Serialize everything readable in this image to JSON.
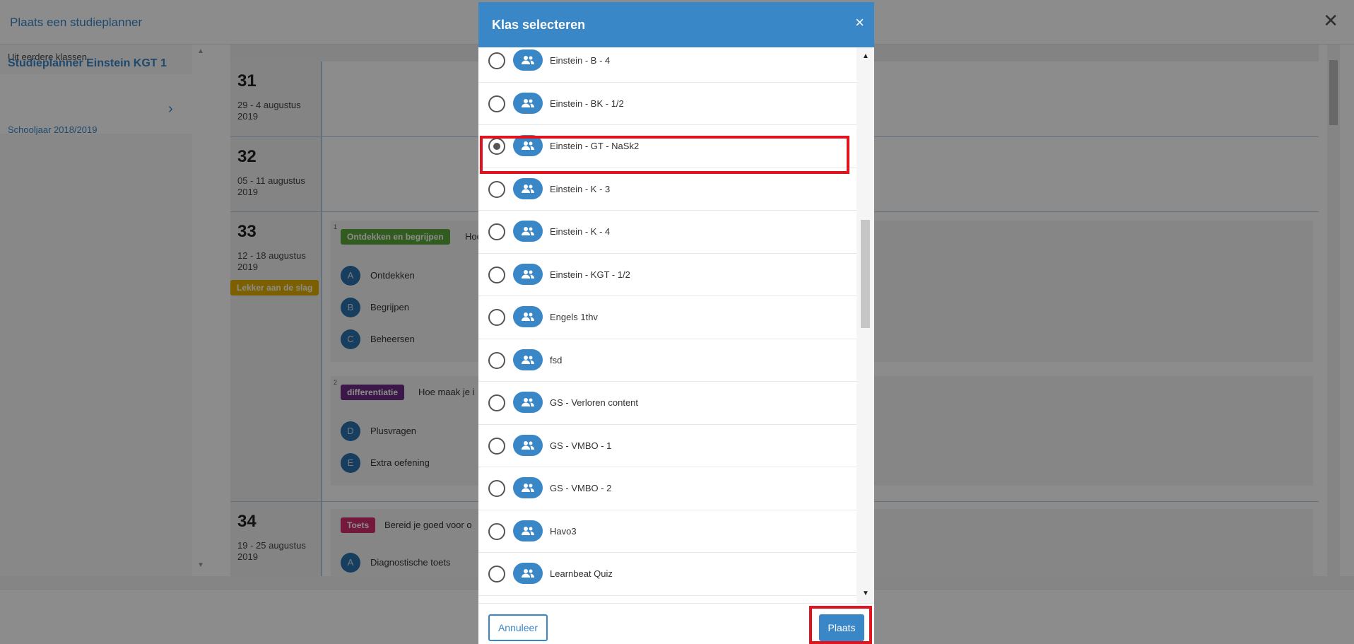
{
  "page": {
    "title": "Plaats een studieplanner",
    "close_icon": "close-icon"
  },
  "sidebar": {
    "previous_label": "Uit eerdere klassen",
    "planner": {
      "title": "Studieplanner Einstein KGT 1",
      "subtitle": "Schooljaar 2018/2019"
    }
  },
  "weeks": [
    {
      "number": "31",
      "dates": "29 - 4 augustus 2019"
    },
    {
      "number": "32",
      "dates": "05 - 11 augustus 2019"
    },
    {
      "number": "33",
      "dates": "12 - 18 augustus 2019",
      "badge": "Lekker aan de slag"
    },
    {
      "number": "34",
      "dates": "19 - 25 augustus 2019"
    }
  ],
  "lessons": [
    {
      "index": "1",
      "chip": "Ontdekken en begrijpen",
      "title": "Hoe",
      "steps": [
        {
          "letter": "A",
          "label": "Ontdekken"
        },
        {
          "letter": "B",
          "label": "Begrijpen"
        },
        {
          "letter": "C",
          "label": "Beheersen"
        }
      ]
    },
    {
      "index": "2",
      "chip": "differentiatie",
      "title": "Hoe maak je i",
      "steps": [
        {
          "letter": "D",
          "label": "Plusvragen"
        },
        {
          "letter": "E",
          "label": "Extra oefening"
        }
      ]
    },
    {
      "chip": "Toets",
      "title": "Bereid je goed voor o",
      "steps": [
        {
          "letter": "A",
          "label": "Diagnostische toets"
        }
      ]
    }
  ],
  "modal": {
    "title": "Klas selecteren",
    "close_symbol": "×",
    "classes": [
      {
        "label": "Einstein - B - 4",
        "selected": false
      },
      {
        "label": "Einstein - BK - 1/2",
        "selected": false
      },
      {
        "label": "Einstein - GT - NaSk2",
        "selected": true
      },
      {
        "label": "Einstein - K - 3",
        "selected": false
      },
      {
        "label": "Einstein - K - 4",
        "selected": false
      },
      {
        "label": "Einstein - KGT - 1/2",
        "selected": false
      },
      {
        "label": "Engels 1thv",
        "selected": false
      },
      {
        "label": "fsd",
        "selected": false
      },
      {
        "label": "GS - Verloren content",
        "selected": false
      },
      {
        "label": "GS - VMBO - 1",
        "selected": false
      },
      {
        "label": "GS - VMBO - 2",
        "selected": false
      },
      {
        "label": "Havo3",
        "selected": false
      },
      {
        "label": "Learnbeat Quiz",
        "selected": false
      }
    ],
    "cancel_label": "Annuleer",
    "place_label": "Plaats"
  },
  "colors": {
    "primary": "#3a87c8",
    "highlight": "#e0141e"
  }
}
